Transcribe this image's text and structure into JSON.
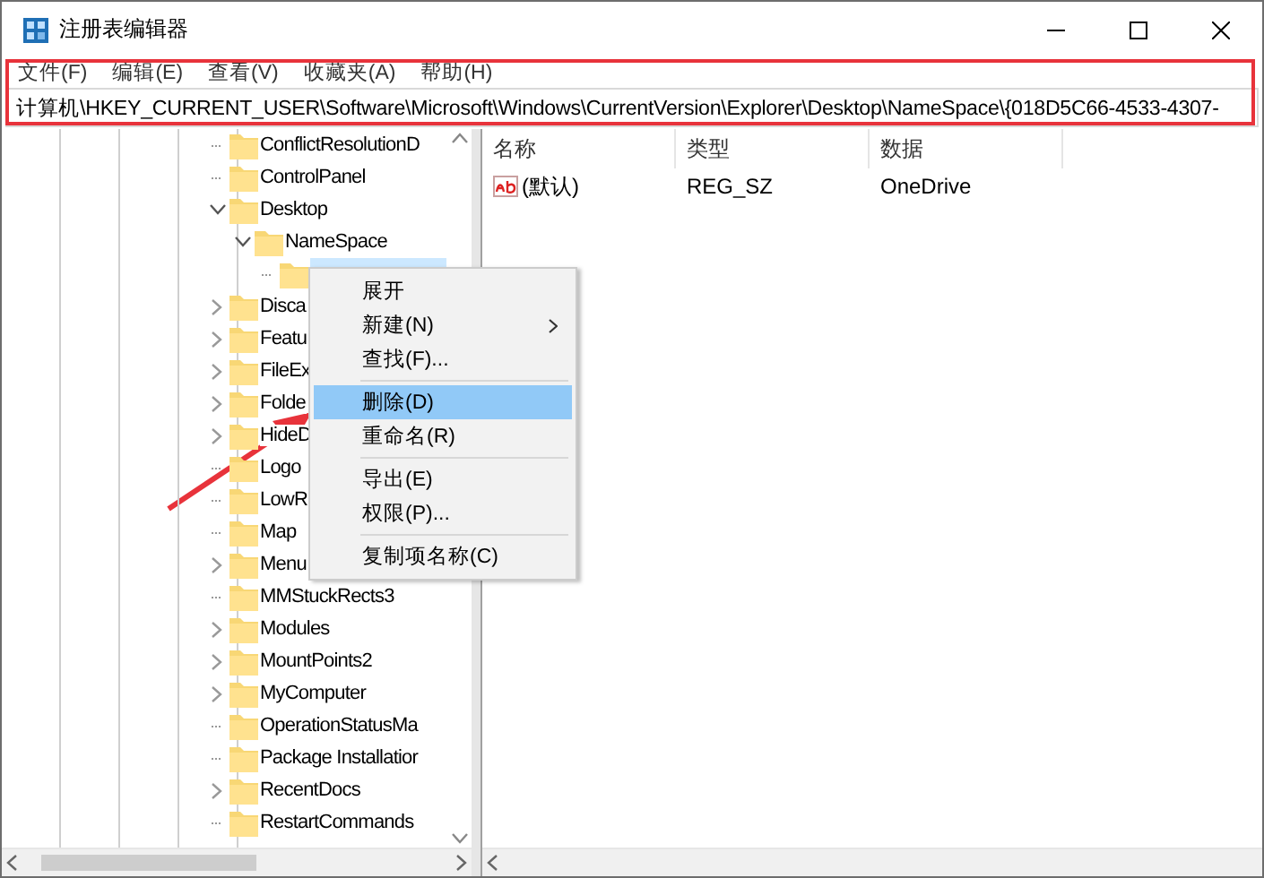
{
  "window": {
    "title": "注册表编辑器"
  },
  "menu_bar": [
    "文件(F)",
    "编辑(E)",
    "查看(V)",
    "收藏夹(A)",
    "帮助(H)"
  ],
  "address_bar": {
    "value": "计算机\\HKEY_CURRENT_USER\\Software\\Microsoft\\Windows\\CurrentVersion\\Explorer\\Desktop\\NameSpace\\{018D5C66-4533-4307-"
  },
  "tree": [
    {
      "label": "ConflictResolutionD",
      "kind": "leaf",
      "selected": false
    },
    {
      "label": "ControlPanel",
      "kind": "leaf",
      "selected": false
    },
    {
      "label": "Desktop",
      "kind": "expanded",
      "selected": false,
      "children": [
        {
          "label": "NameSpace",
          "kind": "expanded",
          "selected": false,
          "children": [
            {
              "kind": "leaf",
              "selected": true
            }
          ]
        }
      ]
    },
    {
      "label": "Disca",
      "kind": "collapsed",
      "selected": false
    },
    {
      "label": "Featu",
      "kind": "collapsed",
      "selected": false
    },
    {
      "label": "FileEx",
      "kind": "collapsed",
      "selected": false
    },
    {
      "label": "Folde",
      "kind": "collapsed",
      "selected": false
    },
    {
      "label": "HideD",
      "kind": "collapsed",
      "selected": false
    },
    {
      "label": "Logo",
      "kind": "leaf",
      "selected": false
    },
    {
      "label": "LowR",
      "kind": "leaf",
      "selected": false
    },
    {
      "label": "Map",
      "kind": "leaf",
      "selected": false
    },
    {
      "label": "Menu",
      "kind": "collapsed",
      "selected": false
    },
    {
      "label": "MMStuckRects3",
      "kind": "leaf",
      "selected": false
    },
    {
      "label": "Modules",
      "kind": "collapsed",
      "selected": false
    },
    {
      "label": "MountPoints2",
      "kind": "collapsed",
      "selected": false
    },
    {
      "label": "MyComputer",
      "kind": "collapsed",
      "selected": false
    },
    {
      "label": "OperationStatusMa",
      "kind": "leaf",
      "selected": false
    },
    {
      "label": "Package Installatior",
      "kind": "leaf",
      "selected": false
    },
    {
      "label": "RecentDocs",
      "kind": "collapsed",
      "selected": false
    },
    {
      "label": "RestartCommands",
      "kind": "leaf",
      "selected": false
    }
  ],
  "values_table": {
    "columns": [
      "名称",
      "类型",
      "数据"
    ],
    "rows": [
      {
        "name": "(默认)",
        "type": "REG_SZ",
        "data": "OneDrive"
      }
    ]
  },
  "context_menu": [
    {
      "kind": "item",
      "label": "展开",
      "selected": false,
      "submenu": false
    },
    {
      "kind": "item",
      "label": "新建(N)",
      "selected": false,
      "submenu": true
    },
    {
      "kind": "item",
      "label": "查找(F)...",
      "selected": false,
      "submenu": false
    },
    {
      "kind": "separator"
    },
    {
      "kind": "item",
      "label": "删除(D)",
      "selected": true,
      "submenu": false
    },
    {
      "kind": "item",
      "label": "重命名(R)",
      "selected": false,
      "submenu": false
    },
    {
      "kind": "separator"
    },
    {
      "kind": "item",
      "label": "导出(E)",
      "selected": false,
      "submenu": false
    },
    {
      "kind": "item",
      "label": "权限(P)...",
      "selected": false,
      "submenu": false
    },
    {
      "kind": "separator"
    },
    {
      "kind": "item",
      "label": "复制项名称(C)",
      "selected": false,
      "submenu": false
    }
  ],
  "annotations": {
    "highlight_frame": true,
    "pointer_arrow": true
  }
}
